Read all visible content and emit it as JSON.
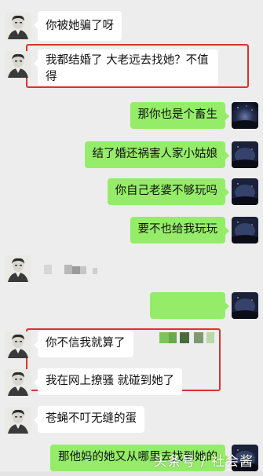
{
  "chat": {
    "messages": [
      {
        "side": "left",
        "text": "你被她骗了呀",
        "avatar": "portrait-avatar-icon"
      },
      {
        "side": "left",
        "text": "我都结婚了 大老远去找她？不值\n得",
        "avatar": "portrait-avatar-icon",
        "highlighted": true
      },
      {
        "side": "right",
        "text": "那你也是个畜生",
        "avatar": "night-sky-avatar-icon"
      },
      {
        "side": "right",
        "text": "结了婚还祸害人家小姑娘",
        "avatar": "night-sky-avatar-icon"
      },
      {
        "side": "right",
        "text": "你自己老婆不够玩吗",
        "avatar": "night-sky-avatar-icon"
      },
      {
        "side": "right",
        "text": "要不也给我玩玩",
        "avatar": "night-sky-avatar-icon"
      },
      {
        "side": "left",
        "text": "",
        "avatar": "portrait-avatar-icon",
        "pixelated": true
      },
      {
        "side": "right",
        "text": "",
        "avatar": "night-sky-avatar-icon",
        "pixelated": true
      },
      {
        "side": "left",
        "text": "你不信我就算了",
        "avatar": "portrait-avatar-icon",
        "highlighted": true
      },
      {
        "side": "left",
        "text": "我在网上撩骚 就碰到她了",
        "avatar": "portrait-avatar-icon",
        "highlighted": true
      },
      {
        "side": "left",
        "text": "苍蝇不叮无缝的蛋",
        "avatar": "portrait-avatar-icon"
      },
      {
        "side": "right",
        "text": "那他妈的她又从哪里去找到她的",
        "avatar": "night-sky-avatar-icon"
      }
    ]
  },
  "watermark": "头条号 / 社会酱",
  "colors": {
    "background": "#ededed",
    "incoming_bubble": "#ffffff",
    "outgoing_bubble": "#95ec69",
    "highlight": "#e0302c"
  }
}
